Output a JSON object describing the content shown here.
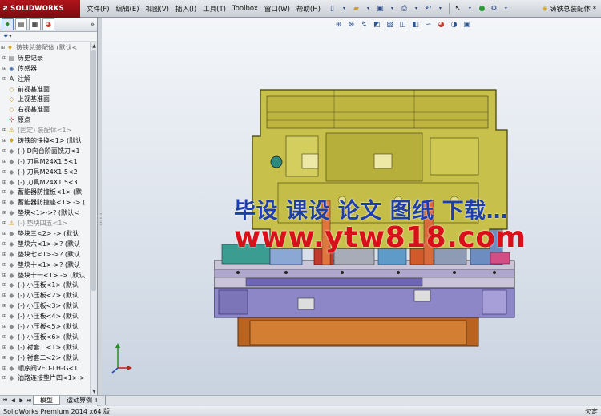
{
  "app": {
    "brand": "SOLIDWORKS",
    "window_title": "铸铁总装配体 *"
  },
  "menu": [
    "文件(F)",
    "编辑(E)",
    "视图(V)",
    "插入(I)",
    "工具(T)",
    "Toolbox",
    "窗口(W)",
    "帮助(H)"
  ],
  "tree": {
    "filter_label": "▾",
    "items": [
      {
        "label": "铸铁总装配体 (默认<",
        "icon": "assembly-icon",
        "kind": "root"
      },
      {
        "label": "历史记录",
        "icon": "history-icon"
      },
      {
        "label": "传感器",
        "icon": "sensor-icon"
      },
      {
        "label": "注解",
        "icon": "annotation-icon"
      },
      {
        "label": "前视基准面",
        "icon": "plane-icon"
      },
      {
        "label": "上视基准面",
        "icon": "plane-icon"
      },
      {
        "label": "右视基准面",
        "icon": "plane-icon"
      },
      {
        "label": "原点",
        "icon": "origin-icon"
      },
      {
        "label": "(固定) 装配体<1>",
        "icon": "subassembly-warning-icon",
        "kind": "gray"
      },
      {
        "label": "铸铁的快换<1> (默认",
        "icon": "assembly-icon"
      },
      {
        "label": "(-) D向台阶面铣刀<1",
        "icon": "part-icon"
      },
      {
        "label": "(-) 刀具M24X1.5<1",
        "icon": "part-icon"
      },
      {
        "label": "(-) 刀具M24X1.5<2",
        "icon": "part-icon"
      },
      {
        "label": "(-) 刀具M24X1.5<3",
        "icon": "part-icon"
      },
      {
        "label": "蓄能器防撞板<1> (默",
        "icon": "part-icon"
      },
      {
        "label": "蓄能器防撞座<1> -> (",
        "icon": "part-icon"
      },
      {
        "label": "垫块<1>->? (默认<",
        "icon": "part-icon"
      },
      {
        "label": "(-) 垫块四五<1>",
        "icon": "part-warning-icon",
        "kind": "gray"
      },
      {
        "label": "垫块三<2> -> (默认",
        "icon": "part-icon"
      },
      {
        "label": "垫块六<1>->? (默认",
        "icon": "part-icon"
      },
      {
        "label": "垫块七<1>->? (默认",
        "icon": "part-icon"
      },
      {
        "label": "垫块十<1>->? (默认",
        "icon": "part-icon"
      },
      {
        "label": "垫块十一<1> -> (默认",
        "icon": "part-icon"
      },
      {
        "label": "(-) 小压板<1> (默认",
        "icon": "part-icon"
      },
      {
        "label": "(-) 小压板<2> (默认",
        "icon": "part-icon"
      },
      {
        "label": "(-) 小压板<3> (默认",
        "icon": "part-icon"
      },
      {
        "label": "(-) 小压板<4> (默认",
        "icon": "part-icon"
      },
      {
        "label": "(-) 小压板<5> (默认",
        "icon": "part-icon"
      },
      {
        "label": "(-) 小压板<6> (默认",
        "icon": "part-icon"
      },
      {
        "label": "(-) 衬套二<1> (默认",
        "icon": "part-icon"
      },
      {
        "label": "(-) 衬套二<2> (默认",
        "icon": "part-icon"
      },
      {
        "label": "顺序阀VED-LH-G<1",
        "icon": "part-icon"
      },
      {
        "label": "油路连接垫片四<1>->",
        "icon": "part-icon"
      }
    ]
  },
  "bottom_tabs": [
    "模型",
    "运动算例 1"
  ],
  "status": {
    "left": "SolidWorks Premium 2014 x64 版",
    "right": "欠定"
  },
  "watermark": {
    "line1": "毕设 课设 论文 图纸 下载…",
    "line2": "www.ytw818.com"
  },
  "colors": {
    "brand_red": "#b0141b",
    "watermark_blue": "#1e3fa8",
    "watermark_red": "#d8101a",
    "casting_yellow": "#c9c24a",
    "fixture_purple": "#8e86c4",
    "base_orange": "#c9742a"
  }
}
